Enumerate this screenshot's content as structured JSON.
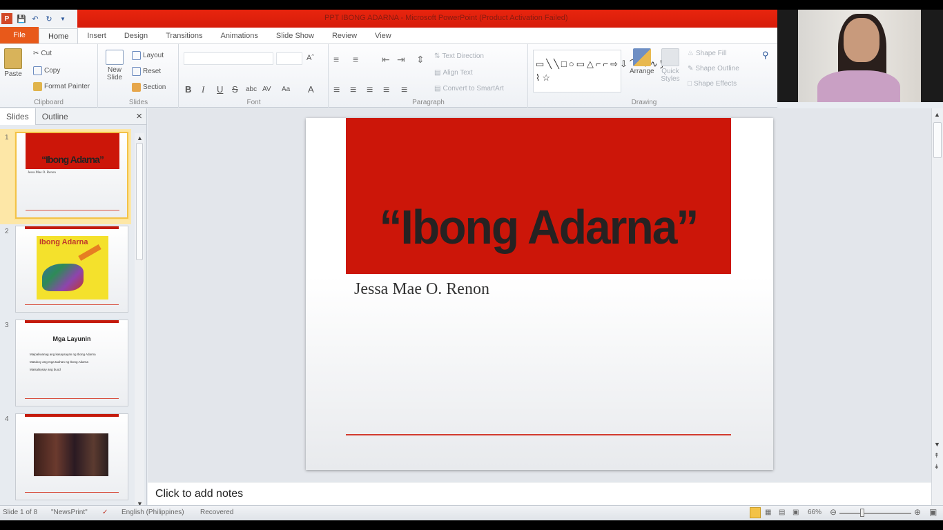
{
  "app": {
    "title": "PPT IBONG ADARNA  -  Microsoft PowerPoint (Product Activation Failed)",
    "logo": "P"
  },
  "tabs": [
    "File",
    "Home",
    "Insert",
    "Design",
    "Transitions",
    "Animations",
    "Slide Show",
    "Review",
    "View"
  ],
  "ribbon": {
    "clipboard": {
      "paste": "Paste",
      "cut": "Cut",
      "copy": "Copy",
      "format_painter": "Format Painter",
      "label": "Clipboard"
    },
    "slides": {
      "new_slide": "New Slide",
      "layout": "Layout",
      "reset": "Reset",
      "section": "Section",
      "label": "Slides"
    },
    "font": {
      "bold": "B",
      "italic": "I",
      "underline": "U",
      "strike": "S",
      "shadow": "abc",
      "spacing": "AV",
      "case": "Aa",
      "label": "Font"
    },
    "paragraph": {
      "text_direction": "Text Direction",
      "align_text": "Align Text",
      "smartart": "Convert to SmartArt",
      "label": "Paragraph"
    },
    "drawing": {
      "arrange": "Arrange",
      "quick_styles": "Quick Styles",
      "shape_fill": "Shape Fill",
      "shape_outline": "Shape Outline",
      "shape_effects": "Shape Effects",
      "label": "Drawing"
    }
  },
  "pane": {
    "tabs": [
      "Slides",
      "Outline"
    ],
    "close": "×"
  },
  "thumbnails": [
    {
      "num": "1",
      "title": "“Ibong Adarna”",
      "sub": "Jessa Mae O. Renon"
    },
    {
      "num": "2",
      "title": "Ibong Adarna"
    },
    {
      "num": "3",
      "title": "Mga Layunin",
      "bullets": [
        "Maipaliwanag ang kasaysayan ng Ibong Adarna",
        "Matukoy ang mga tauhan ng Ibong Adarna",
        "Maisalaysay ang buod"
      ]
    },
    {
      "num": "4"
    }
  ],
  "slide": {
    "title": "“Ibong Adarna”",
    "subtitle": "Jessa Mae O. Renon"
  },
  "notes": {
    "placeholder": "Click to add notes"
  },
  "status": {
    "slide": "Slide 1 of 8",
    "theme": "\"NewsPrint\"",
    "language": "English (Philippines)",
    "state": "Recovered",
    "zoom": "66%"
  }
}
